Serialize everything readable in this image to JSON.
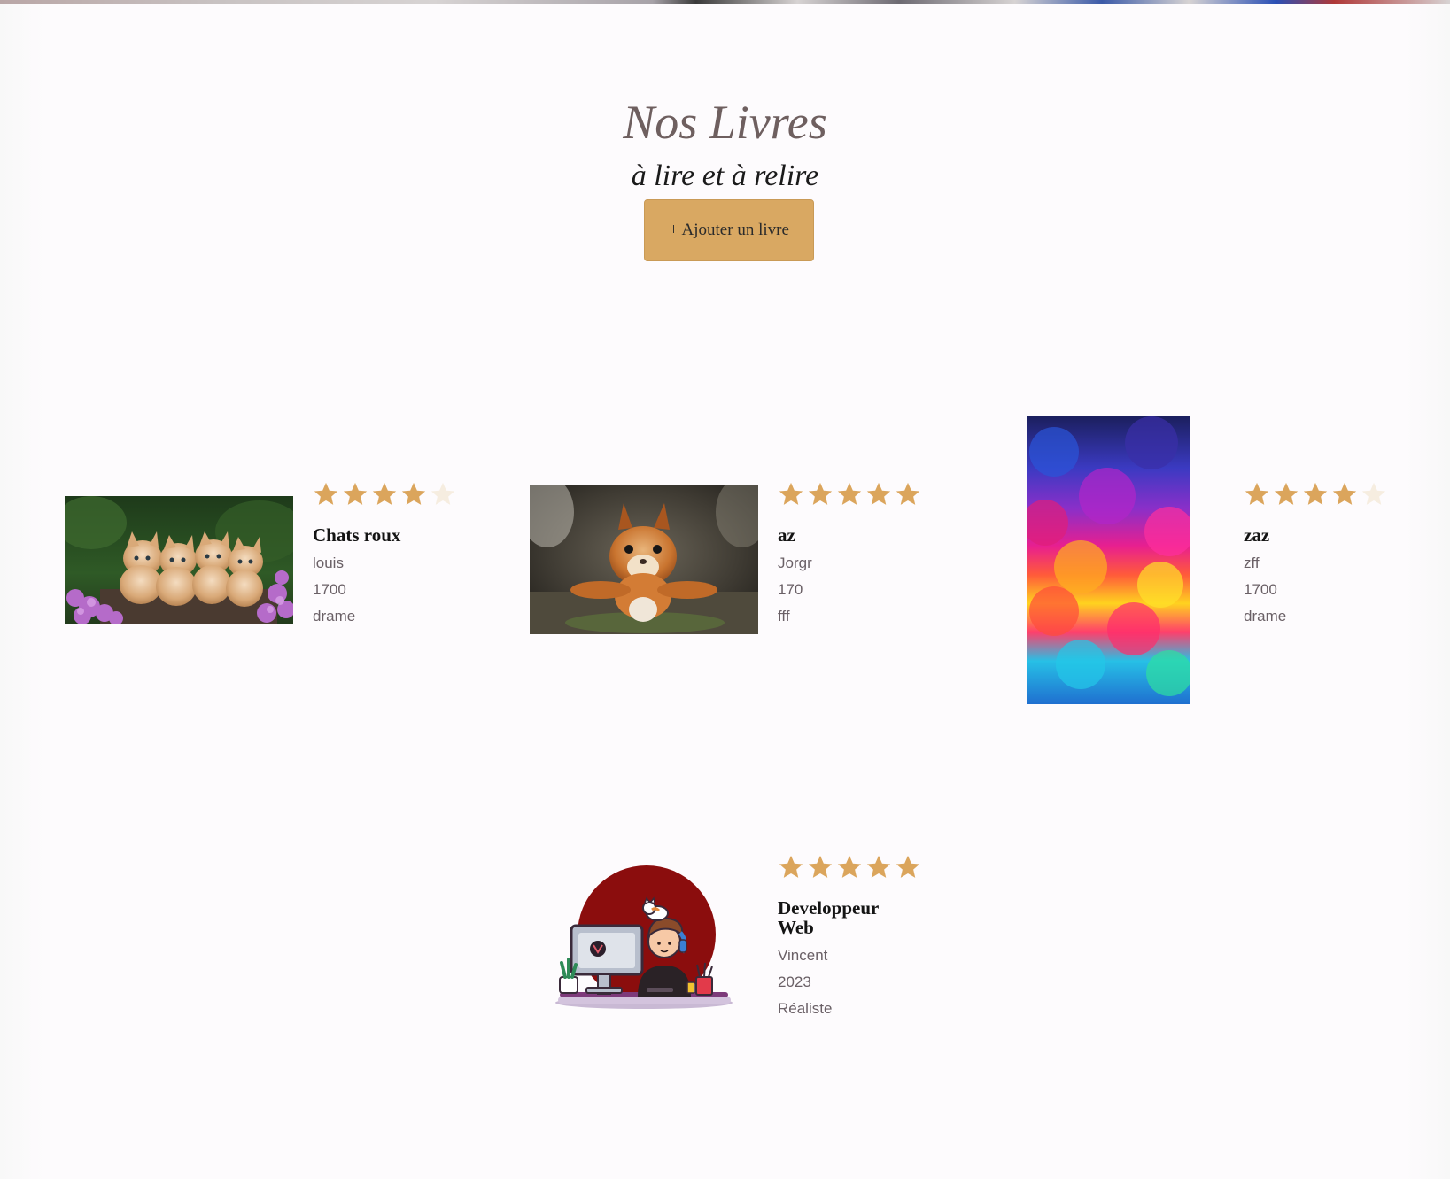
{
  "header": {
    "title": "Nos Livres",
    "subtitle": "à lire et à relire",
    "add_button_label": "+ Ajouter un livre"
  },
  "colors": {
    "accent": "#d9a862",
    "star_filled": "#dba55c",
    "star_empty": "#f6ede0",
    "title_color": "#6e5f5f",
    "meta_color": "#6a6066"
  },
  "books": [
    {
      "title": "Chats roux",
      "author": "louis",
      "year": "1700",
      "genre": "drame",
      "rating": 4,
      "max_rating": 5,
      "cover": "kittens-photo"
    },
    {
      "title": "az",
      "author": "Jorgr",
      "year": "170",
      "genre": "fff",
      "rating": 5,
      "max_rating": 5,
      "cover": "squirrel-photo"
    },
    {
      "title": "zaz",
      "author": "zff",
      "year": "1700",
      "genre": "drame",
      "rating": 4,
      "max_rating": 5,
      "cover": "colorful-clouds-image"
    },
    {
      "title": "Developpeur Web",
      "author": "Vincent",
      "year": "2023",
      "genre": "Réaliste",
      "rating": 5,
      "max_rating": 5,
      "cover": "developer-illustration"
    }
  ]
}
